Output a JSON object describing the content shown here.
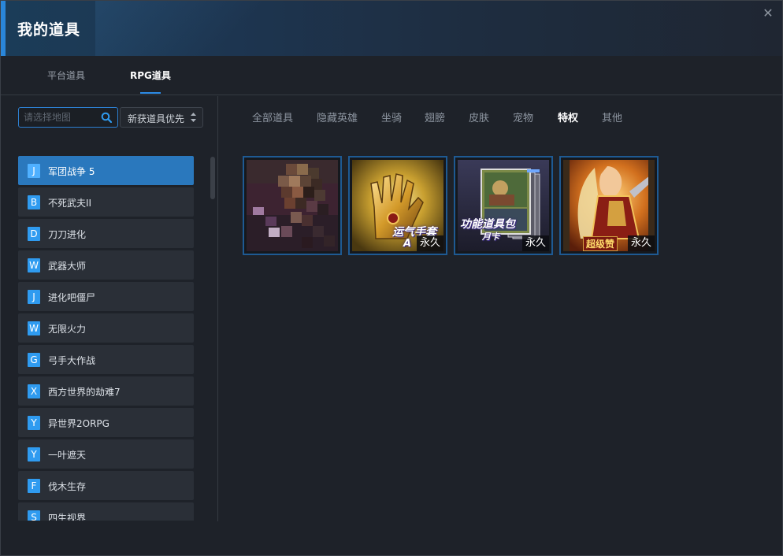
{
  "window": {
    "title": "我的道具",
    "close_symbol": "✕"
  },
  "top_tabs": [
    {
      "label": "平台道具",
      "active": false
    },
    {
      "label": "RPG道具",
      "active": true
    }
  ],
  "search": {
    "placeholder": "请选择地图",
    "value": ""
  },
  "sort": {
    "label": "新获道具优先"
  },
  "games": [
    {
      "letter": "J",
      "name": "军团战争 5",
      "active": true
    },
    {
      "letter": "B",
      "name": "不死武夫II",
      "active": false
    },
    {
      "letter": "D",
      "name": "刀刀进化",
      "active": false
    },
    {
      "letter": "W",
      "name": "武器大师",
      "active": false
    },
    {
      "letter": "J",
      "name": "进化吧僵尸",
      "active": false
    },
    {
      "letter": "W",
      "name": "无限火力",
      "active": false
    },
    {
      "letter": "G",
      "name": "弓手大作战",
      "active": false
    },
    {
      "letter": "X",
      "name": "西方世界的劫难7",
      "active": false
    },
    {
      "letter": "Y",
      "name": "异世界2ORPG",
      "active": false
    },
    {
      "letter": "Y",
      "name": "一叶遮天",
      "active": false
    },
    {
      "letter": "F",
      "name": "伐木生存",
      "active": false
    },
    {
      "letter": "S",
      "name": "四生视界",
      "active": false
    }
  ],
  "categories": [
    {
      "label": "全部道具",
      "active": false
    },
    {
      "label": "隐藏英雄",
      "active": false
    },
    {
      "label": "坐骑",
      "active": false
    },
    {
      "label": "翅膀",
      "active": false
    },
    {
      "label": "皮肤",
      "active": false
    },
    {
      "label": "宠物",
      "active": false
    },
    {
      "label": "特权",
      "active": true
    },
    {
      "label": "其他",
      "active": false
    }
  ],
  "items": [
    {
      "art": "pixelated-character-image",
      "overlay_text": "",
      "overlay_sub": "",
      "duration": ""
    },
    {
      "art": "golden-gauntlet-image",
      "overlay_text": "运气手套",
      "overlay_sub": "A",
      "duration": "永久"
    },
    {
      "art": "item-pack-cards-image",
      "overlay_text": "功能道具包",
      "overlay_sub": "月卡",
      "duration": "永久"
    },
    {
      "art": "armored-warrior-image",
      "overlay_text": "超级赞",
      "overlay_sub": "",
      "duration": "永久"
    }
  ],
  "colors": {
    "accent": "#2d8ce6",
    "card_border": "#1e5a93",
    "active_item": "#2a78bd",
    "letter_badge": "#2f9bf0"
  }
}
